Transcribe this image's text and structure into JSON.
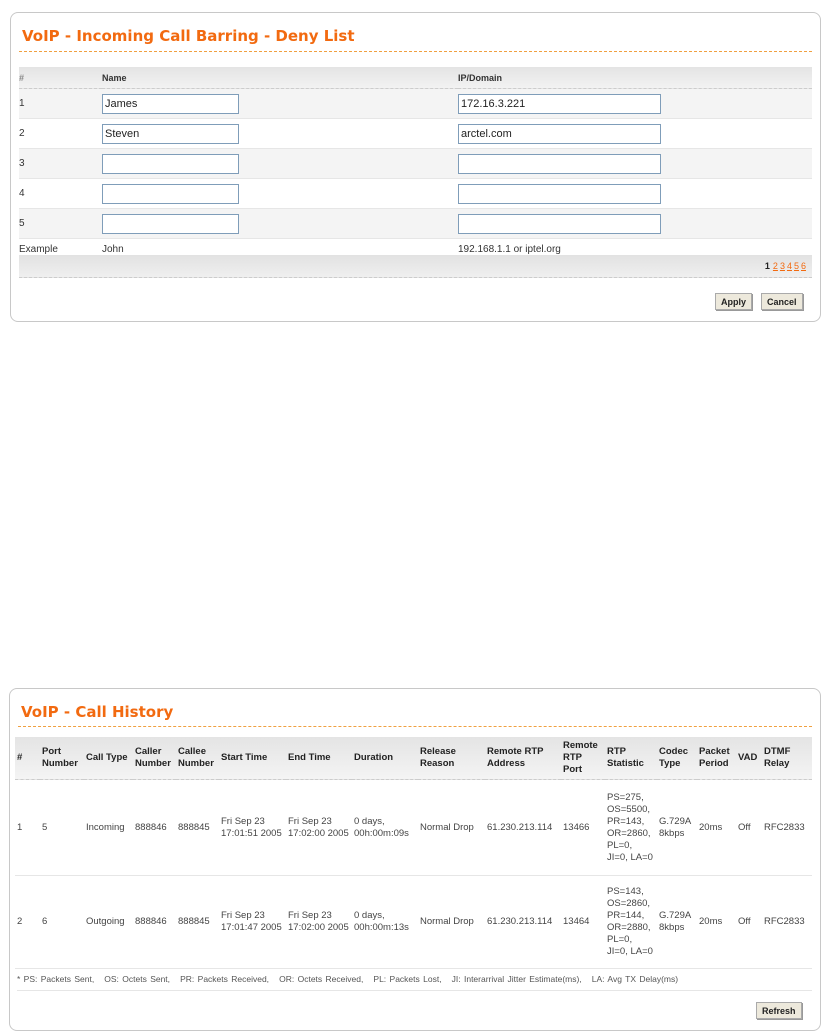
{
  "deny": {
    "title": "VoIP - Incoming Call Barring - Deny List",
    "headers": {
      "num": "#",
      "name": "Name",
      "ip": "IP/Domain"
    },
    "rows": [
      {
        "num": "1",
        "name": "James",
        "ip": "172.16.3.221"
      },
      {
        "num": "2",
        "name": "Steven",
        "ip": "arctel.com"
      },
      {
        "num": "3",
        "name": "",
        "ip": ""
      },
      {
        "num": "4",
        "name": "",
        "ip": ""
      },
      {
        "num": "5",
        "name": "",
        "ip": ""
      }
    ],
    "example": {
      "label": "Example",
      "name": "John",
      "ip": "192.168.1.1 or iptel.org"
    },
    "pages": {
      "current": "1",
      "links": [
        "2",
        "3",
        "4",
        "5",
        "6"
      ]
    },
    "apply": "Apply",
    "cancel": "Cancel"
  },
  "history": {
    "title": "VoIP - Call History",
    "headers": [
      "#",
      "Port Number",
      "Call Type",
      "Caller Number",
      "Callee Number",
      "Start Time",
      "End Time",
      "Duration",
      "Release Reason",
      "Remote RTP Address",
      "Remote RTP Port",
      "RTP Statistic",
      "Codec Type",
      "Packet Period",
      "VAD",
      "DTMF Relay"
    ],
    "rows": [
      [
        "1",
        "5",
        "Incoming",
        "888846",
        "888845",
        "Fri Sep 23 17:01:51 2005",
        "Fri Sep 23 17:02:00 2005",
        "0 days, 00h:00m:09s",
        "Normal Drop",
        "61.230.213.114",
        "13466",
        "PS=275, OS=5500, PR=143, OR=2860, PL=0, JI=0, LA=0",
        "G.729A 8kbps",
        "20ms",
        "Off",
        "RFC2833"
      ],
      [
        "2",
        "6",
        "Outgoing",
        "888846",
        "888845",
        "Fri Sep 23 17:01:47 2005",
        "Fri Sep 23 17:02:00 2005",
        "0 days, 00h:00m:13s",
        "Normal Drop",
        "61.230.213.114",
        "13464",
        "PS=143, OS=2860, PR=144, OR=2880, PL=0, JI=0, LA=0",
        "G.729A 8kbps",
        "20ms",
        "Off",
        "RFC2833"
      ]
    ],
    "footnote": "* PS: Packets Sent,   OS: Octets Sent,   PR: Packets Received,   OR: Octets Received,   PL: Packets Lost,   JI: Interarrival Jitter Estimate(ms),   LA: Avg TX Delay(ms)",
    "refresh": "Refresh"
  }
}
